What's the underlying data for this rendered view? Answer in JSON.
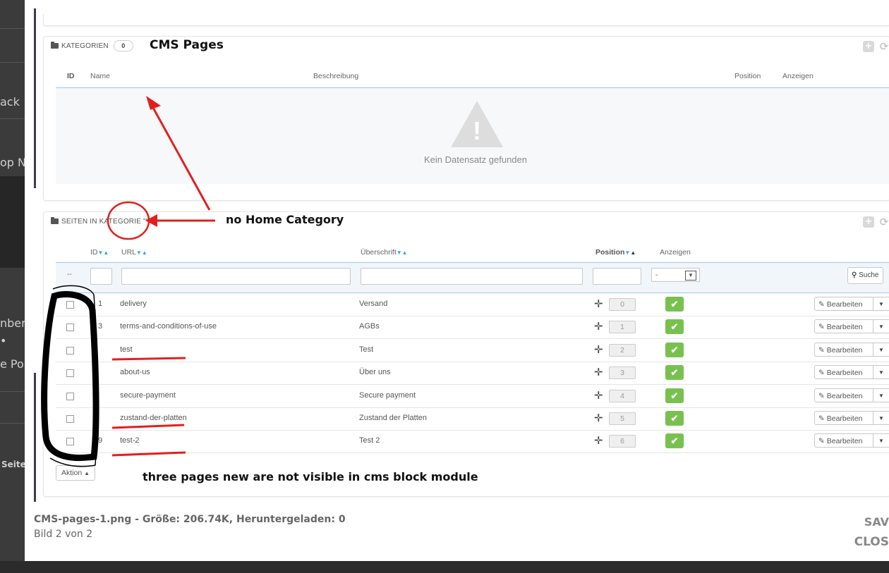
{
  "background": {
    "fragments": [
      "ack",
      "op N",
      "nber",
      "•",
      "e Po",
      "Seite"
    ]
  },
  "screenshot": {
    "categories_panel": {
      "title": "KATEGORIEN",
      "count": "0",
      "columns": [
        "ID",
        "Name",
        "Beschreibung",
        "Position",
        "Anzeigen"
      ],
      "empty_text": "Kein Datensatz gefunden"
    },
    "pages_panel": {
      "title": "SEITEN IN KATEGORIE \"\"",
      "columns": {
        "id": "ID",
        "url": "URL",
        "heading": "Überschrift",
        "position": "Position",
        "display": "Anzeigen"
      },
      "filter": {
        "bulk_placeholder": "--",
        "select_value": "-",
        "search_label": "Suche"
      },
      "rows": [
        {
          "id": "1",
          "url": "delivery",
          "title": "Versand",
          "position": "0"
        },
        {
          "id": "3",
          "url": "terms-and-conditions-of-use",
          "title": "AGBs",
          "position": "1"
        },
        {
          "id": "",
          "url": "test",
          "title": "Test",
          "position": "2"
        },
        {
          "id": "",
          "url": "about-us",
          "title": "Über uns",
          "position": "3"
        },
        {
          "id": "",
          "url": "secure-payment",
          "title": "Secure payment",
          "position": "4"
        },
        {
          "id": "",
          "url": "zustand-der-platten",
          "title": "Zustand der Platten",
          "position": "5"
        },
        {
          "id": "9",
          "url": "test-2",
          "title": "Test 2",
          "position": "6"
        }
      ],
      "edit_label": "Bearbeiten",
      "bulk_action_label": "Aktion"
    },
    "annotations": {
      "cms_pages": "CMS Pages",
      "no_home": "no Home Category",
      "three_pages": "three pages new are not visible in cms block module"
    }
  },
  "caption": {
    "filename": "CMS-pages-1.png - Größe: 206.74K, Heruntergeladen: 0",
    "counter": "Bild 2 von 2"
  },
  "lightbox_buttons": {
    "save": "SAV",
    "close": "CLOS"
  }
}
